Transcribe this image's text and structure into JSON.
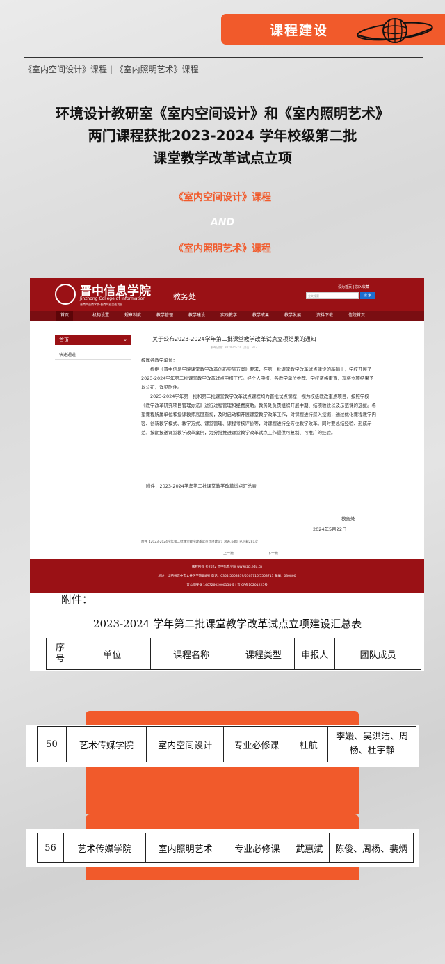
{
  "header": {
    "badge": "课程建设",
    "breadcrumb": "《室内空间设计》课程 | 《室内照明艺术》课程"
  },
  "title_lines": [
    "环境设计教研室《室内空间设计》和《室内照明艺术》",
    "两门课程获批2023-2024 学年校级第二批",
    "课堂教学改革试点立项"
  ],
  "courses": {
    "first": "《室内空间设计》课程",
    "and": "AND",
    "second": "《室内照明艺术》课程"
  },
  "site": {
    "school_name": "晋中信息学院",
    "school_en": "Jinzhong College of Information",
    "motto": "晋商产业商学院·晋商产业全面发展",
    "dept": "教务处",
    "top_links": "设为首页 | 加入收藏",
    "search_placeholder": "全文搜索",
    "search_button": "搜 索",
    "nav": [
      "首页",
      "机构设置",
      "规章制度",
      "教学管理",
      "教学建设",
      "实践教学",
      "教学成果",
      "教学发展",
      "资料下载",
      "信院首页"
    ],
    "sidebar_head": "首页",
    "sidebar_item": "快速通道",
    "article_title": "关于公布2023-2024学年第二批课堂教学改革试点立项结果的通知",
    "article_meta": "发布日期：2024-05-22　点击：313",
    "salutation": "校属各教学单位：",
    "para1": "根据《晋中信息学院课堂教学改革创新实施方案》要求，在第一批课堂教学改革试点建设的基础上，学校开展了2023-2024学年第二批课堂教学改革试点申报工作。经个人申报、各教学单位推荐、学校资格审查，现将立项结果予以公布，详见附件。",
    "para2": "2023-2024学年第一批和第二批课堂教学改革试点课程均为首批试点课程，视为校级教改重点项目，按照学校《教学改革研究项目管理办法》进行过程管理和经费资助。教务处负责组织开展中期、结项验收以及示范课的选拔。希望课程所属单位和授课教师高度重视，及时启动和开展课堂教学改革工作，对课程进行深入挖掘，通过优化课程教学内容、创新教学模式、教学方式、课堂管理、课程考核评价等，对课程进行全方位教学改革。同时要总结经验、形成示范，按期报送课堂教学改革案例，为分批推进课堂教学改革试点工作提供可复制、可推广的经验。",
    "attachment": "附件：2023-2024学年第二批课堂教学改革试点汇总表",
    "sign_dept": "教务处",
    "sign_date": "2024年5月22日",
    "download": "附件【2023-2024学年第二批课堂教学改革试点立项建设汇总表.pdf】已下载281次",
    "prev": "上一篇",
    "next": "下一篇",
    "footer": [
      "版权所有 ©2022 晋中信息学院 www.jzci.edu.cn",
      "地址：山西省晋中市太谷区学院路8号 电话：0354-5503879/5503716/5503711 邮编：030800",
      "晋公网安备 14072602000154号 | 晋ICP备10201225号"
    ]
  },
  "sheet": {
    "label": "附件：",
    "title": "2023-2024 学年第二批课堂教学改革试点立项建设汇总表",
    "headers": [
      "序号",
      "单位",
      "课程名称",
      "课程类型",
      "申报人",
      "团队成员"
    ]
  },
  "rows": [
    {
      "no": "50",
      "unit": "艺术传媒学院",
      "course": "室内空间设计",
      "type": "专业必修课",
      "applicant": "杜航",
      "team_line1": "李媛、吴洪洁、周",
      "team_line2": "杨、杜宇静"
    },
    {
      "no": "56",
      "unit": "艺术传媒学院",
      "course": "室内照明艺术",
      "type": "专业必修课",
      "applicant": "武惠斌",
      "team": "陈俊、周杨、裴炳"
    }
  ],
  "colors": {
    "accent": "#f15a2b",
    "site_red": "#9a1115"
  }
}
